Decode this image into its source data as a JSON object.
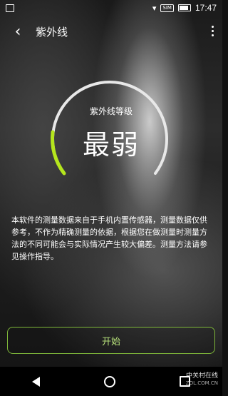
{
  "status_bar": {
    "time": "17:47",
    "badge": "SIM"
  },
  "toolbar": {
    "title": "紫外线",
    "back_glyph": "‹"
  },
  "gauge": {
    "label": "紫外线等级",
    "value": "最弱",
    "level_fraction": 0.12,
    "accent_color": "#b5e61d"
  },
  "description": "本软件的测量数据来自于手机内置传感器，测量数据仅供参考，不作为精确测量的依据，根据您在做测量时测量方法的不同可能会与实际情况产生较大偏差。测量方法请参见操作指导。",
  "actions": {
    "start_label": "开始"
  },
  "watermark": {
    "brand": "中关村在线",
    "domain": "ZOL.COM.CN"
  }
}
